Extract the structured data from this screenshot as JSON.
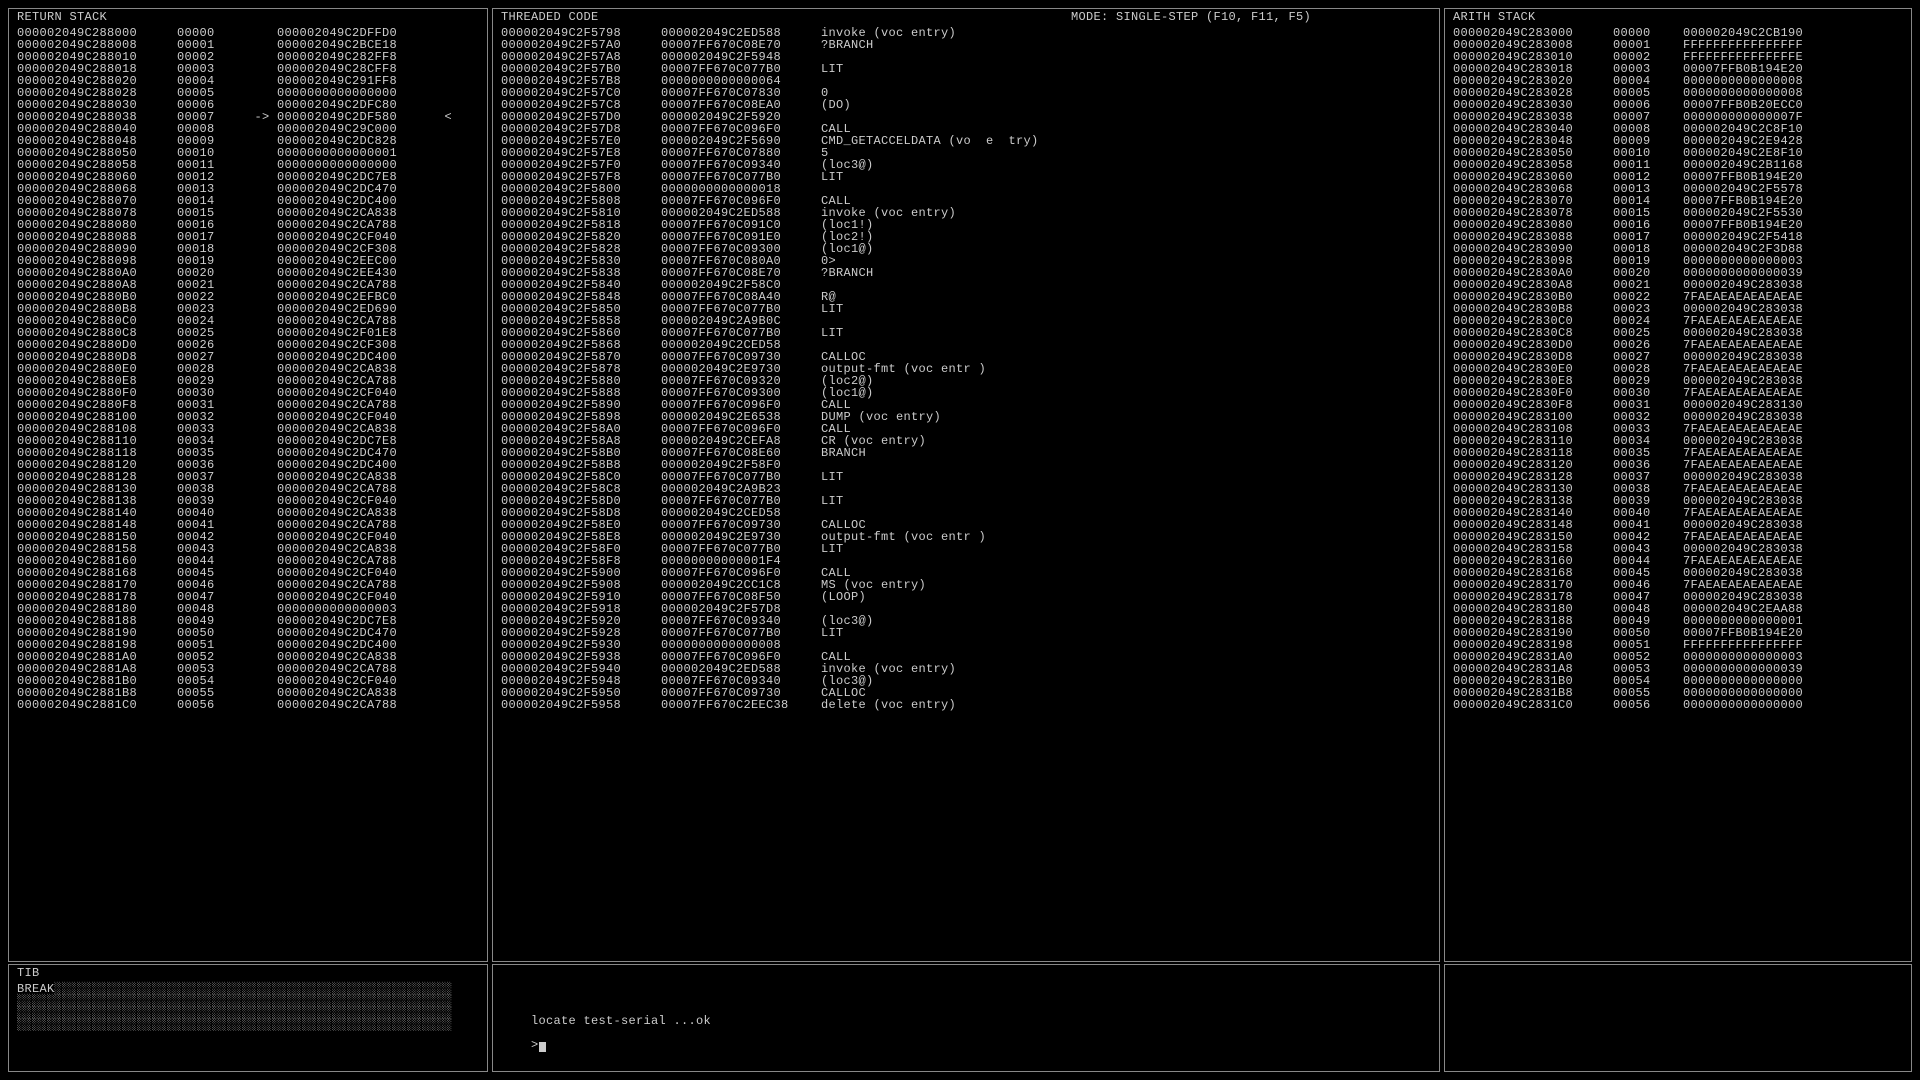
{
  "headers": {
    "return_stack": "RETURN STACK",
    "threaded_code": "THREADED CODE",
    "mode": "MODE: SINGLE-STEP (F10, F11, F5)",
    "arith_stack": "ARITH STACK",
    "tib": "TIB"
  },
  "console_line": "locate test-serial ...ok",
  "prompt": ">",
  "tib_line0": "BREAK",
  "return_stack_rows": [
    {
      "addr": "000002049C288000",
      "idx": "00000",
      "val": "000002049C2DFFD0"
    },
    {
      "addr": "000002049C288008",
      "idx": "00001",
      "val": "000002049C2BCE18"
    },
    {
      "addr": "000002049C288010",
      "idx": "00002",
      "val": "000002049C282FF8"
    },
    {
      "addr": "000002049C288018",
      "idx": "00003",
      "val": "000002049C28CFF8"
    },
    {
      "addr": "000002049C288020",
      "idx": "00004",
      "val": "000002049C291FF8"
    },
    {
      "addr": "000002049C288028",
      "idx": "00005",
      "val": "0000000000000000"
    },
    {
      "addr": "000002049C288030",
      "idx": "00006",
      "val": "000002049C2DFC80"
    },
    {
      "addr": "000002049C288038",
      "idx": "00007",
      "val": "000002049C2DF580",
      "marker": "->",
      "end": "<"
    },
    {
      "addr": "000002049C288040",
      "idx": "00008",
      "val": "000002049C29C000"
    },
    {
      "addr": "000002049C288048",
      "idx": "00009",
      "val": "000002049C2DC828"
    },
    {
      "addr": "000002049C288050",
      "idx": "00010",
      "val": "0000000000000001"
    },
    {
      "addr": "000002049C288058",
      "idx": "00011",
      "val": "0000000000000000"
    },
    {
      "addr": "000002049C288060",
      "idx": "00012",
      "val": "000002049C2DC7E8"
    },
    {
      "addr": "000002049C288068",
      "idx": "00013",
      "val": "000002049C2DC470"
    },
    {
      "addr": "000002049C288070",
      "idx": "00014",
      "val": "000002049C2DC400"
    },
    {
      "addr": "000002049C288078",
      "idx": "00015",
      "val": "000002049C2CA838"
    },
    {
      "addr": "000002049C288080",
      "idx": "00016",
      "val": "000002049C2CA788"
    },
    {
      "addr": "000002049C288088",
      "idx": "00017",
      "val": "000002049C2CF040"
    },
    {
      "addr": "000002049C288090",
      "idx": "00018",
      "val": "000002049C2CF308"
    },
    {
      "addr": "000002049C288098",
      "idx": "00019",
      "val": "000002049C2EEC00"
    },
    {
      "addr": "000002049C2880A0",
      "idx": "00020",
      "val": "000002049C2EE430"
    },
    {
      "addr": "000002049C2880A8",
      "idx": "00021",
      "val": "000002049C2CA788"
    },
    {
      "addr": "000002049C2880B0",
      "idx": "00022",
      "val": "000002049C2EFBC0"
    },
    {
      "addr": "000002049C2880B8",
      "idx": "00023",
      "val": "000002049C2ED690"
    },
    {
      "addr": "000002049C2880C0",
      "idx": "00024",
      "val": "000002049C2CA788"
    },
    {
      "addr": "000002049C2880C8",
      "idx": "00025",
      "val": "000002049C2F01E8"
    },
    {
      "addr": "000002049C2880D0",
      "idx": "00026",
      "val": "000002049C2CF308"
    },
    {
      "addr": "000002049C2880D8",
      "idx": "00027",
      "val": "000002049C2DC400"
    },
    {
      "addr": "000002049C2880E0",
      "idx": "00028",
      "val": "000002049C2CA838"
    },
    {
      "addr": "000002049C2880E8",
      "idx": "00029",
      "val": "000002049C2CA788"
    },
    {
      "addr": "000002049C2880F0",
      "idx": "00030",
      "val": "000002049C2CF040"
    },
    {
      "addr": "000002049C2880F8",
      "idx": "00031",
      "val": "000002049C2CA788"
    },
    {
      "addr": "000002049C288100",
      "idx": "00032",
      "val": "000002049C2CF040"
    },
    {
      "addr": "000002049C288108",
      "idx": "00033",
      "val": "000002049C2CA838"
    },
    {
      "addr": "000002049C288110",
      "idx": "00034",
      "val": "000002049C2DC7E8"
    },
    {
      "addr": "000002049C288118",
      "idx": "00035",
      "val": "000002049C2DC470"
    },
    {
      "addr": "000002049C288120",
      "idx": "00036",
      "val": "000002049C2DC400"
    },
    {
      "addr": "000002049C288128",
      "idx": "00037",
      "val": "000002049C2CA838"
    },
    {
      "addr": "000002049C288130",
      "idx": "00038",
      "val": "000002049C2CA788"
    },
    {
      "addr": "000002049C288138",
      "idx": "00039",
      "val": "000002049C2CF040"
    },
    {
      "addr": "000002049C288140",
      "idx": "00040",
      "val": "000002049C2CA838"
    },
    {
      "addr": "000002049C288148",
      "idx": "00041",
      "val": "000002049C2CA788"
    },
    {
      "addr": "000002049C288150",
      "idx": "00042",
      "val": "000002049C2CF040"
    },
    {
      "addr": "000002049C288158",
      "idx": "00043",
      "val": "000002049C2CA838"
    },
    {
      "addr": "000002049C288160",
      "idx": "00044",
      "val": "000002049C2CA788"
    },
    {
      "addr": "000002049C288168",
      "idx": "00045",
      "val": "000002049C2CF040"
    },
    {
      "addr": "000002049C288170",
      "idx": "00046",
      "val": "000002049C2CA788"
    },
    {
      "addr": "000002049C288178",
      "idx": "00047",
      "val": "000002049C2CF040"
    },
    {
      "addr": "000002049C288180",
      "idx": "00048",
      "val": "0000000000000003"
    },
    {
      "addr": "000002049C288188",
      "idx": "00049",
      "val": "000002049C2DC7E8"
    },
    {
      "addr": "000002049C288190",
      "idx": "00050",
      "val": "000002049C2DC470"
    },
    {
      "addr": "000002049C288198",
      "idx": "00051",
      "val": "000002049C2DC400"
    },
    {
      "addr": "000002049C2881A0",
      "idx": "00052",
      "val": "000002049C2CA838"
    },
    {
      "addr": "000002049C2881A8",
      "idx": "00053",
      "val": "000002049C2CA788"
    },
    {
      "addr": "000002049C2881B0",
      "idx": "00054",
      "val": "000002049C2CF040"
    },
    {
      "addr": "000002049C2881B8",
      "idx": "00055",
      "val": "000002049C2CA838"
    },
    {
      "addr": "000002049C2881C0",
      "idx": "00056",
      "val": "000002049C2CA788"
    }
  ],
  "threaded_code_rows": [
    {
      "a": "000002049C2F5798",
      "b": "000002049C2ED588",
      "c": "invoke (voc entry)"
    },
    {
      "a": "000002049C2F57A0",
      "b": "00007FF670C08E70",
      "c": "?BRANCH"
    },
    {
      "a": "000002049C2F57A8",
      "b": "000002049C2F5948",
      "c": ""
    },
    {
      "a": "000002049C2F57B0",
      "b": "00007FF670C077B0",
      "c": "LIT"
    },
    {
      "a": "000002049C2F57B8",
      "b": "0000000000000064",
      "c": ""
    },
    {
      "a": "000002049C2F57C0",
      "b": "00007FF670C07830",
      "c": "0"
    },
    {
      "a": "000002049C2F57C8",
      "b": "00007FF670C08EA0",
      "c": "(DO)"
    },
    {
      "a": "000002049C2F57D0",
      "b": "000002049C2F5920",
      "c": ""
    },
    {
      "a": "000002049C2F57D8",
      "b": "00007FF670C096F0",
      "c": "CALL"
    },
    {
      "a": "000002049C2F57E0",
      "b": "000002049C2F5690",
      "c": "CMD_GETACCELDATA (vo  e  try)"
    },
    {
      "a": "000002049C2F57E8",
      "b": "00007FF670C07880",
      "c": "5"
    },
    {
      "a": "000002049C2F57F0",
      "b": "00007FF670C09340",
      "c": "(loc3@)"
    },
    {
      "a": "000002049C2F57F8",
      "b": "00007FF670C077B0",
      "c": "LIT"
    },
    {
      "a": "000002049C2F5800",
      "b": "0000000000000018",
      "c": ""
    },
    {
      "a": "000002049C2F5808",
      "b": "00007FF670C096F0",
      "c": "CALL"
    },
    {
      "a": "000002049C2F5810",
      "b": "000002049C2ED588",
      "c": "invoke (voc entry)"
    },
    {
      "a": "000002049C2F5818",
      "b": "00007FF670C091C0",
      "c": "(loc1!)"
    },
    {
      "a": "000002049C2F5820",
      "b": "00007FF670C091E0",
      "c": "(loc2!)"
    },
    {
      "a": "000002049C2F5828",
      "b": "00007FF670C09300",
      "c": "(loc1@)"
    },
    {
      "a": "000002049C2F5830",
      "b": "00007FF670C080A0",
      "c": "0>"
    },
    {
      "a": "000002049C2F5838",
      "b": "00007FF670C08E70",
      "c": "?BRANCH"
    },
    {
      "a": "000002049C2F5840",
      "b": "000002049C2F58C0",
      "c": ""
    },
    {
      "a": "000002049C2F5848",
      "b": "00007FF670C08A40",
      "c": "R@"
    },
    {
      "a": "000002049C2F5850",
      "b": "00007FF670C077B0",
      "c": "LIT"
    },
    {
      "a": "000002049C2F5858",
      "b": "000002049C2A9B0C",
      "c": ""
    },
    {
      "a": "000002049C2F5860",
      "b": "00007FF670C077B0",
      "c": "LIT"
    },
    {
      "a": "000002049C2F5868",
      "b": "000002049C2CED58",
      "c": ""
    },
    {
      "a": "000002049C2F5870",
      "b": "00007FF670C09730",
      "c": "CALLOC"
    },
    {
      "a": "000002049C2F5878",
      "b": "000002049C2E9730",
      "c": "output-fmt (voc entr )"
    },
    {
      "a": "000002049C2F5880",
      "b": "00007FF670C09320",
      "c": "(loc2@)"
    },
    {
      "a": "000002049C2F5888",
      "b": "00007FF670C09300",
      "c": "(loc1@)"
    },
    {
      "a": "000002049C2F5890",
      "b": "00007FF670C096F0",
      "c": "CALL"
    },
    {
      "a": "000002049C2F5898",
      "b": "000002049C2E6538",
      "c": "DUMP (voc entry)"
    },
    {
      "a": "000002049C2F58A0",
      "b": "00007FF670C096F0",
      "c": "CALL"
    },
    {
      "a": "000002049C2F58A8",
      "b": "000002049C2CEFA8",
      "c": "CR (voc entry)"
    },
    {
      "a": "000002049C2F58B0",
      "b": "00007FF670C08E60",
      "c": "BRANCH"
    },
    {
      "a": "000002049C2F58B8",
      "b": "000002049C2F58F0",
      "c": ""
    },
    {
      "a": "000002049C2F58C0",
      "b": "00007FF670C077B0",
      "c": "LIT"
    },
    {
      "a": "000002049C2F58C8",
      "b": "000002049C2A9B23",
      "c": ""
    },
    {
      "a": "000002049C2F58D0",
      "b": "00007FF670C077B0",
      "c": "LIT"
    },
    {
      "a": "000002049C2F58D8",
      "b": "000002049C2CED58",
      "c": ""
    },
    {
      "a": "000002049C2F58E0",
      "b": "00007FF670C09730",
      "c": "CALLOC"
    },
    {
      "a": "000002049C2F58E8",
      "b": "000002049C2E9730",
      "c": "output-fmt (voc entr )"
    },
    {
      "a": "000002049C2F58F0",
      "b": "00007FF670C077B0",
      "c": "LIT"
    },
    {
      "a": "000002049C2F58F8",
      "b": "00000000000001F4",
      "c": ""
    },
    {
      "a": "000002049C2F5900",
      "b": "00007FF670C096F0",
      "c": "CALL"
    },
    {
      "a": "000002049C2F5908",
      "b": "000002049C2CC1C8",
      "c": "MS (voc entry)"
    },
    {
      "a": "000002049C2F5910",
      "b": "00007FF670C08F50",
      "c": "(LOOP)"
    },
    {
      "a": "000002049C2F5918",
      "b": "000002049C2F57D8",
      "c": ""
    },
    {
      "a": "000002049C2F5920",
      "b": "00007FF670C09340",
      "c": "(loc3@)"
    },
    {
      "a": "000002049C2F5928",
      "b": "00007FF670C077B0",
      "c": "LIT"
    },
    {
      "a": "000002049C2F5930",
      "b": "0000000000000008",
      "c": ""
    },
    {
      "a": "000002049C2F5938",
      "b": "00007FF670C096F0",
      "c": "CALL"
    },
    {
      "a": "000002049C2F5940",
      "b": "000002049C2ED588",
      "c": "invoke (voc entry)"
    },
    {
      "a": "000002049C2F5948",
      "b": "00007FF670C09340",
      "c": "(loc3@)"
    },
    {
      "a": "000002049C2F5950",
      "b": "00007FF670C09730",
      "c": "CALLOC"
    },
    {
      "a": "000002049C2F5958",
      "b": "00007FF670C2EEC38",
      "c": "delete (voc entry)"
    }
  ],
  "arith_stack_rows": [
    {
      "a": "000002049C283000",
      "i": "00000",
      "v": "000002049C2CB190"
    },
    {
      "a": "000002049C283008",
      "i": "00001",
      "v": "FFFFFFFFFFFFFFFF"
    },
    {
      "a": "000002049C283010",
      "i": "00002",
      "v": "FFFFFFFFFFFFFFFE"
    },
    {
      "a": "000002049C283018",
      "i": "00003",
      "v": "00007FFB0B194E20"
    },
    {
      "a": "000002049C283020",
      "i": "00004",
      "v": "0000000000000008"
    },
    {
      "a": "000002049C283028",
      "i": "00005",
      "v": "0000000000000008"
    },
    {
      "a": "000002049C283030",
      "i": "00006",
      "v": "00007FFB0B20ECC0"
    },
    {
      "a": "000002049C283038",
      "i": "00007",
      "v": "000000000000007F"
    },
    {
      "a": "000002049C283040",
      "i": "00008",
      "v": "000002049C2C8F10"
    },
    {
      "a": "000002049C283048",
      "i": "00009",
      "v": "000002049C2E9428"
    },
    {
      "a": "000002049C283050",
      "i": "00010",
      "v": "000002049C2E8F10"
    },
    {
      "a": "000002049C283058",
      "i": "00011",
      "v": "000002049C2B1168"
    },
    {
      "a": "000002049C283060",
      "i": "00012",
      "v": "00007FFB0B194E20"
    },
    {
      "a": "000002049C283068",
      "i": "00013",
      "v": "000002049C2F5578"
    },
    {
      "a": "000002049C283070",
      "i": "00014",
      "v": "00007FFB0B194E20"
    },
    {
      "a": "000002049C283078",
      "i": "00015",
      "v": "000002049C2F5530"
    },
    {
      "a": "000002049C283080",
      "i": "00016",
      "v": "00007FFB0B194E20"
    },
    {
      "a": "000002049C283088",
      "i": "00017",
      "v": "000002049C2F5418"
    },
    {
      "a": "000002049C283090",
      "i": "00018",
      "v": "000002049C2F3D88"
    },
    {
      "a": "000002049C283098",
      "i": "00019",
      "v": "0000000000000003"
    },
    {
      "a": "000002049C2830A0",
      "i": "00020",
      "v": "0000000000000039"
    },
    {
      "a": "000002049C2830A8",
      "i": "00021",
      "v": "000002049C283038"
    },
    {
      "a": "000002049C2830B0",
      "i": "00022",
      "v": "7FAEAEAEAEAEAEAE"
    },
    {
      "a": "000002049C2830B8",
      "i": "00023",
      "v": "000002049C283038"
    },
    {
      "a": "000002049C2830C0",
      "i": "00024",
      "v": "7FAEAEAEAEAEAEAE"
    },
    {
      "a": "000002049C2830C8",
      "i": "00025",
      "v": "000002049C283038"
    },
    {
      "a": "000002049C2830D0",
      "i": "00026",
      "v": "7FAEAEAEAEAEAEAE"
    },
    {
      "a": "000002049C2830D8",
      "i": "00027",
      "v": "000002049C283038"
    },
    {
      "a": "000002049C2830E0",
      "i": "00028",
      "v": "7FAEAEAEAEAEAEAE"
    },
    {
      "a": "000002049C2830E8",
      "i": "00029",
      "v": "000002049C283038"
    },
    {
      "a": "000002049C2830F0",
      "i": "00030",
      "v": "7FAEAEAEAEAEAEAE"
    },
    {
      "a": "000002049C2830F8",
      "i": "00031",
      "v": "000002049C283130"
    },
    {
      "a": "000002049C283100",
      "i": "00032",
      "v": "000002049C283038"
    },
    {
      "a": "000002049C283108",
      "i": "00033",
      "v": "7FAEAEAEAEAEAEAE"
    },
    {
      "a": "000002049C283110",
      "i": "00034",
      "v": "000002049C283038"
    },
    {
      "a": "000002049C283118",
      "i": "00035",
      "v": "7FAEAEAEAEAEAEAE"
    },
    {
      "a": "000002049C283120",
      "i": "00036",
      "v": "7FAEAEAEAEAEAEAE"
    },
    {
      "a": "000002049C283128",
      "i": "00037",
      "v": "000002049C283038"
    },
    {
      "a": "000002049C283130",
      "i": "00038",
      "v": "7FAEAEAEAEAEAEAE"
    },
    {
      "a": "000002049C283138",
      "i": "00039",
      "v": "000002049C283038"
    },
    {
      "a": "000002049C283140",
      "i": "00040",
      "v": "7FAEAEAEAEAEAEAE"
    },
    {
      "a": "000002049C283148",
      "i": "00041",
      "v": "000002049C283038"
    },
    {
      "a": "000002049C283150",
      "i": "00042",
      "v": "7FAEAEAEAEAEAEAE"
    },
    {
      "a": "000002049C283158",
      "i": "00043",
      "v": "000002049C283038"
    },
    {
      "a": "000002049C283160",
      "i": "00044",
      "v": "7FAEAEAEAEAEAEAE"
    },
    {
      "a": "000002049C283168",
      "i": "00045",
      "v": "000002049C283038"
    },
    {
      "a": "000002049C283170",
      "i": "00046",
      "v": "7FAEAEAEAEAEAEAE"
    },
    {
      "a": "000002049C283178",
      "i": "00047",
      "v": "000002049C283038"
    },
    {
      "a": "000002049C283180",
      "i": "00048",
      "v": "000002049C2EAA88"
    },
    {
      "a": "000002049C283188",
      "i": "00049",
      "v": "0000000000000001"
    },
    {
      "a": "000002049C283190",
      "i": "00050",
      "v": "00007FFB0B194E20"
    },
    {
      "a": "000002049C283198",
      "i": "00051",
      "v": "FFFFFFFFFFFFFFFF"
    },
    {
      "a": "000002049C2831A0",
      "i": "00052",
      "v": "0000000000000003"
    },
    {
      "a": "000002049C2831A8",
      "i": "00053",
      "v": "0000000000000039"
    },
    {
      "a": "000002049C2831B0",
      "i": "00054",
      "v": "0000000000000000"
    },
    {
      "a": "000002049C2831B8",
      "i": "00055",
      "v": "0000000000000000"
    },
    {
      "a": "000002049C2831C0",
      "i": "00056",
      "v": "0000000000000000"
    }
  ]
}
